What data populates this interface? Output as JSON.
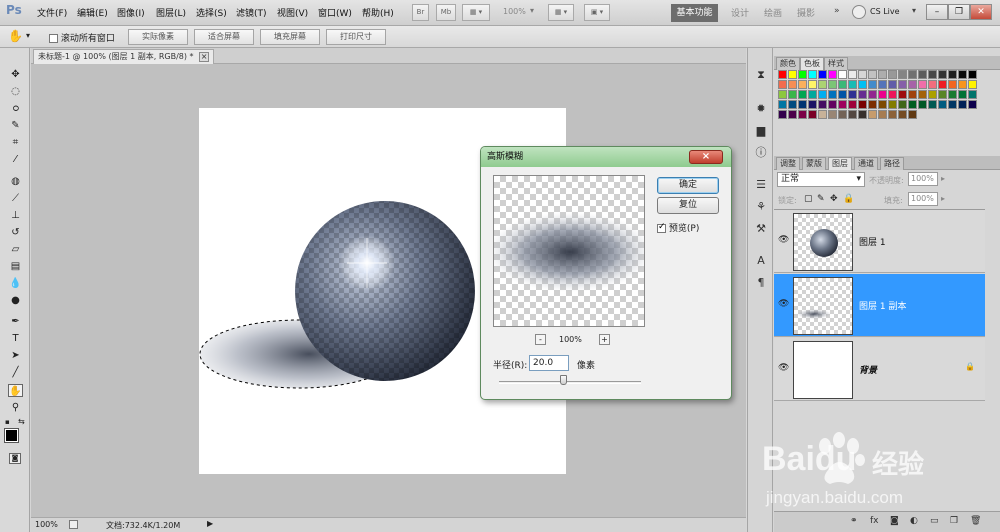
{
  "app": {
    "logo": "Ps"
  },
  "menu": [
    "文件(F)",
    "编辑(E)",
    "图像(I)",
    "图层(L)",
    "选择(S)",
    "滤镜(T)",
    "视图(V)",
    "窗口(W)",
    "帮助(H)"
  ],
  "toolbar": {
    "zoom_value": "100%",
    "mb_label": "Mb"
  },
  "workspaces": {
    "active": "基本功能",
    "items": [
      "设计",
      "绘画",
      "摄影"
    ],
    "more": "»",
    "cslive": "CS Live"
  },
  "options_bar": {
    "scroll_all": "滚动所有窗口",
    "scroll_all_checked": false,
    "buttons": [
      "实际像素",
      "适合屏幕",
      "填充屏幕",
      "打印尺寸"
    ]
  },
  "document": {
    "tab_title": "未标题-1 @ 100% (图层 1 副本, RGB/8) *",
    "tab_close": "×"
  },
  "status": {
    "zoom": "100%",
    "doc_info": "文档:732.4K/1.20M"
  },
  "dialog": {
    "title": "高斯模糊",
    "close": "×",
    "ok": "确定",
    "reset": "复位",
    "preview_label": "预览(P)",
    "preview_checked": true,
    "zoom_out": "-",
    "zoom_in": "+",
    "zoom": "100%",
    "radius_label": "半径(R):",
    "radius_value": "20.0",
    "unit": "像素",
    "slider_value_fraction": 0.52
  },
  "swatch_panel": {
    "tabs": [
      "颜色",
      "色板",
      "样式"
    ],
    "active": "色板"
  },
  "layers_panel": {
    "tabs": [
      "调整",
      "蒙版",
      "图层",
      "通道",
      "路径"
    ],
    "active": "图层",
    "blend_mode": "正常",
    "opacity_label": "不透明度:",
    "opacity": "100%",
    "lock_label": "锁定:",
    "fill_label": "填充:",
    "fill": "100%",
    "layers": [
      {
        "name": "图层 1",
        "selected": false,
        "locked": false
      },
      {
        "name": "图层 1 副本",
        "selected": true,
        "locked": false
      },
      {
        "name": "背景",
        "selected": false,
        "locked": true
      }
    ]
  },
  "watermark": {
    "brand": "Baidu",
    "cn": "经验",
    "url": "jingyan.baidu.com"
  }
}
